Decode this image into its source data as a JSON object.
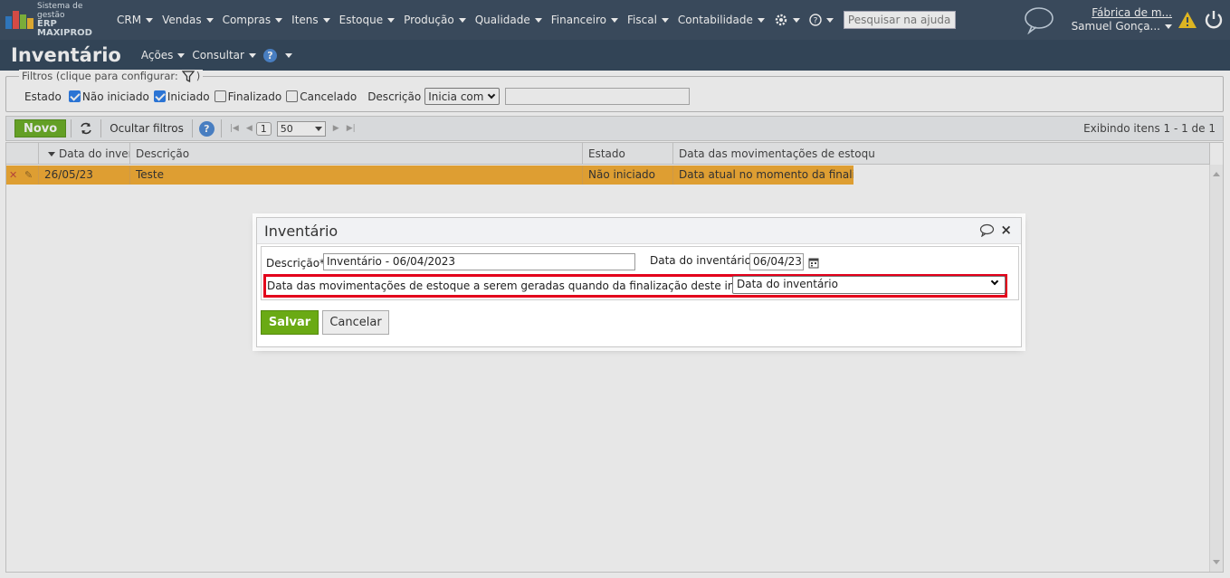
{
  "app": {
    "logo_line1": "Sistema de gestão",
    "logo_line2": "ERP MAXIPROD"
  },
  "menu": [
    {
      "label": "CRM"
    },
    {
      "label": "Vendas"
    },
    {
      "label": "Compras"
    },
    {
      "label": "Itens"
    },
    {
      "label": "Estoque"
    },
    {
      "label": "Produção"
    },
    {
      "label": "Qualidade"
    },
    {
      "label": "Financeiro"
    },
    {
      "label": "Fiscal"
    },
    {
      "label": "Contabilidade"
    }
  ],
  "top_icons": {
    "settings": "gear-icon",
    "help": "help-icon",
    "chat": "chat-bubble-icon",
    "warning": "warning-icon",
    "power": "power-icon"
  },
  "search": {
    "placeholder": "Pesquisar na ajuda..."
  },
  "user": {
    "company": "Fábrica de m...",
    "name": "Samuel Gonça..."
  },
  "page": {
    "title": "Inventário",
    "menu_acoes": "Ações",
    "menu_consultar": "Consultar",
    "help_glyph": "?"
  },
  "filters": {
    "legend": "Filtros (clique para configurar:",
    "legend_end": ")",
    "estado_label": "Estado",
    "options": [
      {
        "label": "Não iniciado",
        "checked": true
      },
      {
        "label": "Iniciado",
        "checked": true
      },
      {
        "label": "Finalizado",
        "checked": false
      },
      {
        "label": "Cancelado",
        "checked": false
      }
    ],
    "descricao_label": "Descrição",
    "descricao_mode": "Inicia com",
    "descricao_value": ""
  },
  "toolbar": {
    "novo": "Novo",
    "ocultar_filtros": "Ocultar filtros",
    "page": "1",
    "per_page": "50",
    "status": "Exibindo itens 1 - 1 de 1"
  },
  "grid": {
    "columns": [
      "Data do inventário",
      "Descrição",
      "Estado",
      "Data das movimentações de estoqu"
    ],
    "rows": [
      {
        "data": "26/05/23",
        "descricao": "Teste",
        "estado": "Não iniciado",
        "data_mov": "Data atual no momento da finali..."
      }
    ]
  },
  "dialog": {
    "title": "Inventário",
    "descricao_label": "Descrição*",
    "descricao_value": "Inventário - 06/04/2023",
    "data_label": "Data do inventário*",
    "data_value": "06/04/23",
    "mov_label": "Data das movimentações de estoque a serem geradas quando da finalização deste inventário*",
    "mov_value": "Data do inventário",
    "salvar": "Salvar",
    "cancelar": "Cancelar"
  },
  "colors": {
    "topbar": "#2b3f55",
    "accent_green": "#6aaa14",
    "row_highlight": "#f5a623",
    "highlight_border": "#e3001b"
  }
}
